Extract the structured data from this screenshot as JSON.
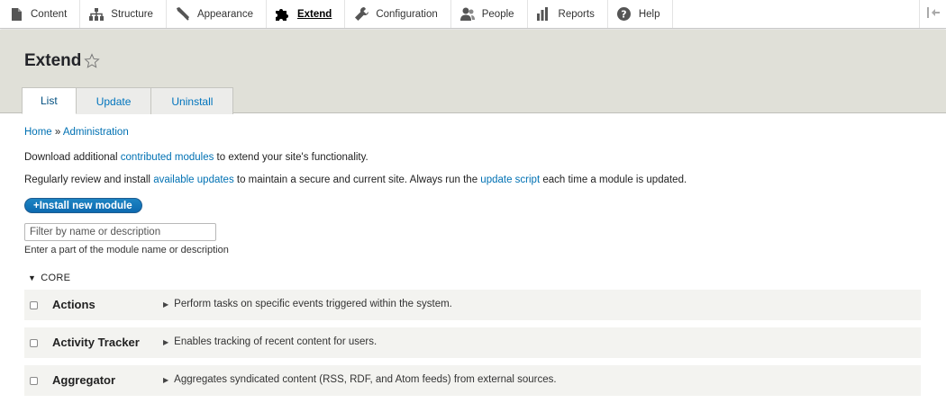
{
  "toolbar": {
    "items": [
      {
        "label": "Content",
        "icon": "page-icon"
      },
      {
        "label": "Structure",
        "icon": "structure-icon"
      },
      {
        "label": "Appearance",
        "icon": "brush-icon"
      },
      {
        "label": "Extend",
        "icon": "puzzle-icon"
      },
      {
        "label": "Configuration",
        "icon": "wrench-icon"
      },
      {
        "label": "People",
        "icon": "people-icon"
      },
      {
        "label": "Reports",
        "icon": "bar-chart-icon"
      },
      {
        "label": "Help",
        "icon": "help-icon"
      }
    ],
    "active": "Extend"
  },
  "page": {
    "title": "Extend"
  },
  "tabs": [
    {
      "label": "List"
    },
    {
      "label": "Update"
    },
    {
      "label": "Uninstall"
    }
  ],
  "breadcrumb": {
    "home": "Home",
    "sep": "»",
    "admin": "Administration"
  },
  "intro": {
    "p1_before": "Download additional ",
    "p1_link": "contributed modules",
    "p1_after": " to extend your site's functionality.",
    "p2_before": "Regularly review and install ",
    "p2_link1": "available updates",
    "p2_mid": " to maintain a secure and current site. Always run the ",
    "p2_link2": "update script",
    "p2_after": " each time a module is updated."
  },
  "install_button": "+Install new module",
  "filter": {
    "placeholder": "Filter by name or description",
    "description": "Enter a part of the module name or description"
  },
  "group": {
    "label": "CORE"
  },
  "modules": [
    {
      "name": "Actions",
      "description": "Perform tasks on specific events triggered within the system."
    },
    {
      "name": "Activity Tracker",
      "description": "Enables tracking of recent content for users."
    },
    {
      "name": "Aggregator",
      "description": "Aggregates syndicated content (RSS, RDF, and Atom feeds) from external sources."
    }
  ],
  "colors": {
    "link": "#0071b3",
    "header_bg": "#e0e0d8",
    "button": "#0c6ab0",
    "row_bg": "#f3f3f0"
  }
}
